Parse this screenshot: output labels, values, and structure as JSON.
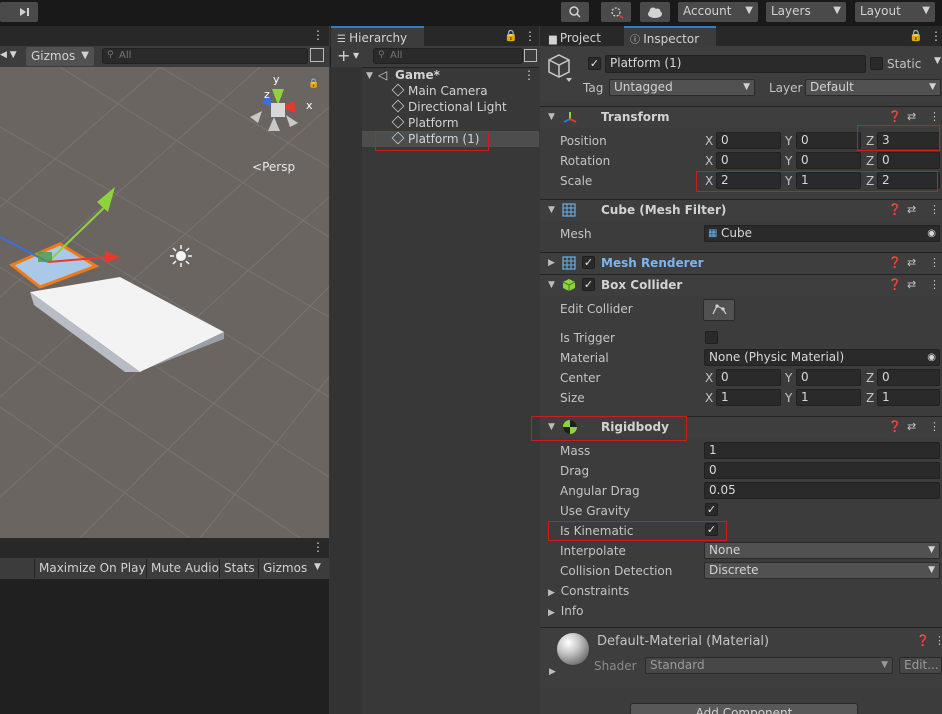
{
  "toolbar": {
    "account": "Account",
    "layers": "Layers",
    "layout": "Layout"
  },
  "scene": {
    "gizmos": "Gizmos",
    "search_placeholder": "All",
    "persp_label": "Persp",
    "axis_y": "y",
    "axis_x": "x",
    "axis_z": "z"
  },
  "game": {
    "maximize_on_play": "Maximize On Play",
    "mute_audio": "Mute Audio",
    "stats": "Stats",
    "gizmos": "Gizmos"
  },
  "hierarchy": {
    "tab_label": "Hierarchy",
    "search_placeholder": "All",
    "scene_name": "Game*",
    "items": [
      "Main Camera",
      "Directional Light",
      "Platform",
      "Platform (1)"
    ]
  },
  "inspector": {
    "project_tab": "Project",
    "inspector_tab": "Inspector",
    "object_name": "Platform (1)",
    "static_label": "Static",
    "tag_label": "Tag",
    "tag_value": "Untagged",
    "layer_label": "Layer",
    "layer_value": "Default",
    "transform": {
      "title": "Transform",
      "position_label": "Position",
      "rotation_label": "Rotation",
      "scale_label": "Scale",
      "position": {
        "x": "0",
        "y": "0",
        "z": "3"
      },
      "rotation": {
        "x": "0",
        "y": "0",
        "z": "0"
      },
      "scale": {
        "x": "2",
        "y": "1",
        "z": "2"
      }
    },
    "mesh_filter": {
      "title": "Cube (Mesh Filter)",
      "mesh_label": "Mesh",
      "mesh_value": "Cube"
    },
    "mesh_renderer": {
      "title": "Mesh Renderer"
    },
    "box_collider": {
      "title": "Box Collider",
      "edit_collider_label": "Edit Collider",
      "is_trigger_label": "Is Trigger",
      "material_label": "Material",
      "material_value": "None (Physic Material)",
      "center_label": "Center",
      "center": {
        "x": "0",
        "y": "0",
        "z": "0"
      },
      "size_label": "Size",
      "size": {
        "x": "1",
        "y": "1",
        "z": "1"
      }
    },
    "rigidbody": {
      "title": "Rigidbody",
      "mass_label": "Mass",
      "mass": "1",
      "drag_label": "Drag",
      "drag": "0",
      "angular_drag_label": "Angular Drag",
      "angular_drag": "0.05",
      "use_gravity_label": "Use Gravity",
      "is_kinematic_label": "Is Kinematic",
      "interpolate_label": "Interpolate",
      "interpolate_value": "None",
      "collision_detection_label": "Collision Detection",
      "collision_detection_value": "Discrete",
      "constraints_label": "Constraints",
      "info_label": "Info"
    },
    "material": {
      "title": "Default-Material (Material)",
      "shader_label": "Shader",
      "shader_value": "Standard",
      "edit_label": "Edit..."
    },
    "add_component": "Add Component"
  },
  "axis_labels": {
    "x": "X",
    "y": "Y",
    "z": "Z"
  },
  "colors": {
    "accent": "#3a79bb",
    "highlight_red": "#d11a1a",
    "scene_bg": "#6b6561"
  }
}
